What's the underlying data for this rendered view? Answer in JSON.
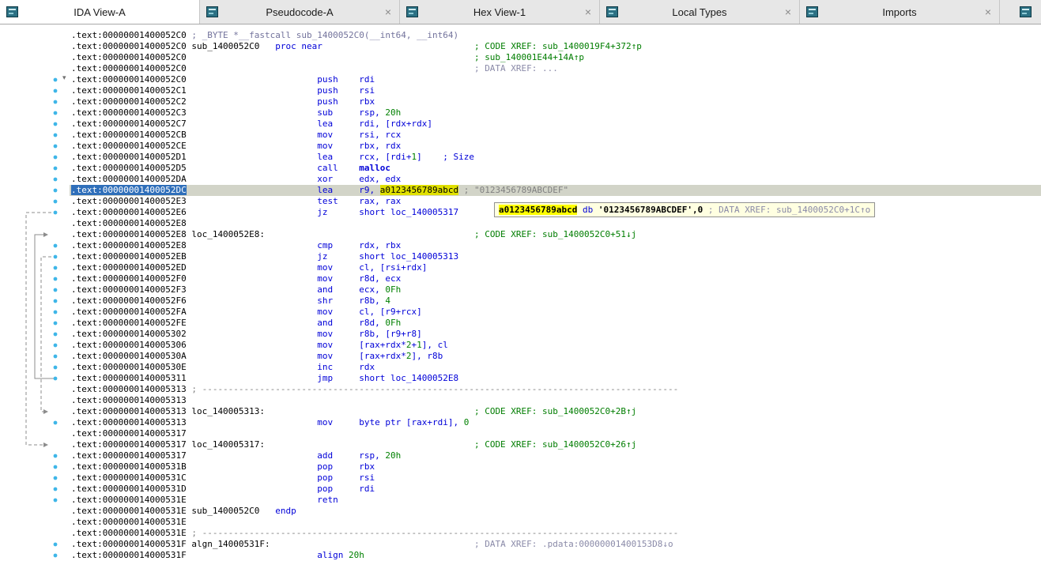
{
  "palette": {
    "tabbar_bg": "#e7e7e7",
    "tab_active_bg": "#ffffff",
    "tab_text": "#1a1a1a",
    "close": "#8a8a8a",
    "icon_bg": "#2c7184",
    "icon_line": "#cde9ee",
    "listing_bg": "#ffffff",
    "addr": "#000000",
    "instr": "#0000d8",
    "number": "#008000",
    "xref_code": "#007d00",
    "xref_data": "#8a8aa8",
    "proto": "#73739c",
    "comment": "#808080",
    "dashes": "#7f7f7f",
    "hl_line_bg": "#d2d4c8",
    "addr_sel_bg": "#2f6fba",
    "addr_sel_fg": "#ffffff",
    "ident_hl_bg": "#e0e000",
    "tooltip_bg": "#ffffe1",
    "tooltip_border": "#919191",
    "dot": "#3eb6e8",
    "arrow": "#8c8c8c"
  },
  "tabbar": {
    "close_glyph": "×"
  },
  "tabs": [
    {
      "label": "IDA View-A",
      "icon": "ida-view",
      "active": true,
      "close": false
    },
    {
      "label": "Pseudocode-A",
      "icon": "pseudocode",
      "active": false,
      "close": true
    },
    {
      "label": "Hex View-1",
      "icon": "hex-view",
      "active": false,
      "close": true
    },
    {
      "label": "Local Types",
      "icon": "local-types",
      "active": false,
      "close": true
    },
    {
      "label": "Imports",
      "icon": "imports",
      "active": false,
      "close": true
    }
  ],
  "tooltip": {
    "tokens": [
      [
        "a0123456789abcd",
        "hlb",
        "highlighted-identifier"
      ],
      [
        " ",
        "k"
      ],
      [
        "db ",
        "b"
      ],
      [
        "'0123456789ABCDEF',0",
        "kb"
      ],
      [
        " ",
        "k"
      ],
      [
        "; DATA XREF: sub_1400052C0+1C↑o",
        "v"
      ]
    ]
  },
  "listing": {
    "arrows": [
      {
        "style": "solid",
        "lane": 44,
        "from": 31,
        "to": 18
      },
      {
        "style": "dashed",
        "lane": 33,
        "from": 16,
        "to": 37
      },
      {
        "style": "dashed",
        "lane": 52,
        "from": 20,
        "to": 34
      }
    ],
    "lines": [
      {
        "a": ".text:00000001400052C0",
        "t": [
          [
            " ; _BYTE *__fastcall sub_1400052C0(__int64, __int64)",
            "p"
          ]
        ]
      },
      {
        "a": ".text:00000001400052C0",
        "t": [
          [
            " sub_1400052C0",
            "k"
          ],
          [
            "   proc near",
            "b"
          ],
          [
            "                             ; CODE XREF: sub_1400019F4+372↑p",
            "g"
          ]
        ]
      },
      {
        "a": ".text:00000001400052C0",
        "t": [
          [
            "                                                       ; sub_140001E44+14A↑p",
            "g"
          ]
        ]
      },
      {
        "a": ".text:00000001400052C0",
        "t": [
          [
            "                                                       ; DATA XREF: ...",
            "v"
          ]
        ]
      },
      {
        "a": ".text:00000001400052C0",
        "dot": true,
        "fold": true,
        "t": [
          [
            "                         push    rdi",
            "b"
          ]
        ]
      },
      {
        "a": ".text:00000001400052C1",
        "dot": true,
        "t": [
          [
            "                         push    rsi",
            "b"
          ]
        ]
      },
      {
        "a": ".text:00000001400052C2",
        "dot": true,
        "t": [
          [
            "                         push    rbx",
            "b"
          ]
        ]
      },
      {
        "a": ".text:00000001400052C3",
        "dot": true,
        "t": [
          [
            "                         sub     rsp, ",
            "b"
          ],
          [
            "20h",
            "n"
          ]
        ]
      },
      {
        "a": ".text:00000001400052C7",
        "dot": true,
        "t": [
          [
            "                         lea     rdi, [rdx+rdx]",
            "b"
          ]
        ]
      },
      {
        "a": ".text:00000001400052CB",
        "dot": true,
        "t": [
          [
            "                         mov     rsi, rcx",
            "b"
          ]
        ]
      },
      {
        "a": ".text:00000001400052CE",
        "dot": true,
        "t": [
          [
            "                         mov     rbx, rdx",
            "b"
          ]
        ]
      },
      {
        "a": ".text:00000001400052D1",
        "dot": true,
        "t": [
          [
            "                         lea     rcx, [rdi+",
            "b"
          ],
          [
            "1",
            "n"
          ],
          [
            "]    ; Size",
            "b"
          ]
        ]
      },
      {
        "a": ".text:00000001400052D5",
        "dot": true,
        "t": [
          [
            "                         call    ",
            "b"
          ],
          [
            "malloc",
            "bb",
            "callee-name"
          ]
        ]
      },
      {
        "a": ".text:00000001400052DA",
        "dot": true,
        "t": [
          [
            "                         xor     edx, edx",
            "b"
          ]
        ]
      },
      {
        "a": ".text:00000001400052DC",
        "dot": true,
        "hl": true,
        "t": [
          [
            "                         lea     r9, ",
            "b"
          ],
          [
            "a0123456789abcd",
            "hl",
            "highlighted-identifier"
          ],
          [
            " ",
            "k"
          ],
          [
            "; \"0123456789ABCDEF\"",
            "c"
          ]
        ]
      },
      {
        "a": ".text:00000001400052E3",
        "dot": true,
        "t": [
          [
            "                         test    rax, rax",
            "b"
          ]
        ]
      },
      {
        "a": ".text:00000001400052E6",
        "dot": true,
        "t": [
          [
            "                         jz      short loc_140005317",
            "b"
          ]
        ]
      },
      {
        "a": ".text:00000001400052E8",
        "t": []
      },
      {
        "a": ".text:00000001400052E8",
        "t": [
          [
            " loc_1400052E8:",
            "k"
          ],
          [
            "                                        ; CODE XREF: sub_1400052C0+51↓j",
            "g"
          ]
        ]
      },
      {
        "a": ".text:00000001400052E8",
        "dot": true,
        "t": [
          [
            "                         cmp     rdx, rbx",
            "b"
          ]
        ]
      },
      {
        "a": ".text:00000001400052EB",
        "dot": true,
        "t": [
          [
            "                         jz      short loc_140005313",
            "b"
          ]
        ]
      },
      {
        "a": ".text:00000001400052ED",
        "dot": true,
        "t": [
          [
            "                         mov     cl, [rsi+rdx]",
            "b"
          ]
        ]
      },
      {
        "a": ".text:00000001400052F0",
        "dot": true,
        "t": [
          [
            "                         mov     r8d, ecx",
            "b"
          ]
        ]
      },
      {
        "a": ".text:00000001400052F3",
        "dot": true,
        "t": [
          [
            "                         and     ecx, ",
            "b"
          ],
          [
            "0Fh",
            "n"
          ]
        ]
      },
      {
        "a": ".text:00000001400052F6",
        "dot": true,
        "t": [
          [
            "                         shr     r8b, ",
            "b"
          ],
          [
            "4",
            "n"
          ]
        ]
      },
      {
        "a": ".text:00000001400052FA",
        "dot": true,
        "t": [
          [
            "                         mov     cl, [r9+rcx]",
            "b"
          ]
        ]
      },
      {
        "a": ".text:00000001400052FE",
        "dot": true,
        "t": [
          [
            "                         and     r8d, ",
            "b"
          ],
          [
            "0Fh",
            "n"
          ]
        ]
      },
      {
        "a": ".text:0000000140005302",
        "dot": true,
        "t": [
          [
            "                         mov     r8b, [r9+r8]",
            "b"
          ]
        ]
      },
      {
        "a": ".text:0000000140005306",
        "dot": true,
        "t": [
          [
            "                         mov     [rax+rdx*",
            "b"
          ],
          [
            "2",
            "n"
          ],
          [
            "+",
            "b"
          ],
          [
            "1",
            "n"
          ],
          [
            "], cl",
            "b"
          ]
        ]
      },
      {
        "a": ".text:000000014000530A",
        "dot": true,
        "t": [
          [
            "                         mov     [rax+rdx*",
            "b"
          ],
          [
            "2",
            "n"
          ],
          [
            "], r8b",
            "b"
          ]
        ]
      },
      {
        "a": ".text:000000014000530E",
        "dot": true,
        "t": [
          [
            "                         inc     rdx",
            "b"
          ]
        ]
      },
      {
        "a": ".text:0000000140005311",
        "dot": true,
        "t": [
          [
            "                         jmp     short loc_1400052E8",
            "b"
          ]
        ]
      },
      {
        "a": ".text:0000000140005313",
        "t": [
          [
            " ; -------------------------------------------------------------------------------------------",
            "d"
          ]
        ]
      },
      {
        "a": ".text:0000000140005313",
        "t": []
      },
      {
        "a": ".text:0000000140005313",
        "t": [
          [
            " loc_140005313:",
            "k"
          ],
          [
            "                                        ; CODE XREF: sub_1400052C0+2B↑j",
            "g"
          ]
        ]
      },
      {
        "a": ".text:0000000140005313",
        "dot": true,
        "t": [
          [
            "                         mov     byte ptr [rax+rdi], ",
            "b"
          ],
          [
            "0",
            "n"
          ]
        ]
      },
      {
        "a": ".text:0000000140005317",
        "t": []
      },
      {
        "a": ".text:0000000140005317",
        "t": [
          [
            " loc_140005317:",
            "k"
          ],
          [
            "                                        ; CODE XREF: sub_1400052C0+26↑j",
            "g"
          ]
        ]
      },
      {
        "a": ".text:0000000140005317",
        "dot": true,
        "t": [
          [
            "                         add     rsp, ",
            "b"
          ],
          [
            "20h",
            "n"
          ]
        ]
      },
      {
        "a": ".text:000000014000531B",
        "dot": true,
        "t": [
          [
            "                         pop     rbx",
            "b"
          ]
        ]
      },
      {
        "a": ".text:000000014000531C",
        "dot": true,
        "t": [
          [
            "                         pop     rsi",
            "b"
          ]
        ]
      },
      {
        "a": ".text:000000014000531D",
        "dot": true,
        "t": [
          [
            "                         pop     rdi",
            "b"
          ]
        ]
      },
      {
        "a": ".text:000000014000531E",
        "dot": true,
        "t": [
          [
            "                         retn",
            "b"
          ]
        ]
      },
      {
        "a": ".text:000000014000531E",
        "t": [
          [
            " sub_1400052C0",
            "k"
          ],
          [
            "   endp",
            "b"
          ]
        ]
      },
      {
        "a": ".text:000000014000531E",
        "t": []
      },
      {
        "a": ".text:000000014000531E",
        "t": [
          [
            " ; -------------------------------------------------------------------------------------------",
            "d"
          ]
        ]
      },
      {
        "a": ".text:000000014000531F",
        "dot": true,
        "t": [
          [
            " algn_14000531F:",
            "k"
          ],
          [
            "                                       ; DATA XREF: .pdata:00000001400153D8↓o",
            "v"
          ]
        ]
      },
      {
        "a": ".text:000000014000531F",
        "dot": true,
        "t": [
          [
            "                         align ",
            "b"
          ],
          [
            "20h",
            "n"
          ]
        ]
      }
    ]
  }
}
